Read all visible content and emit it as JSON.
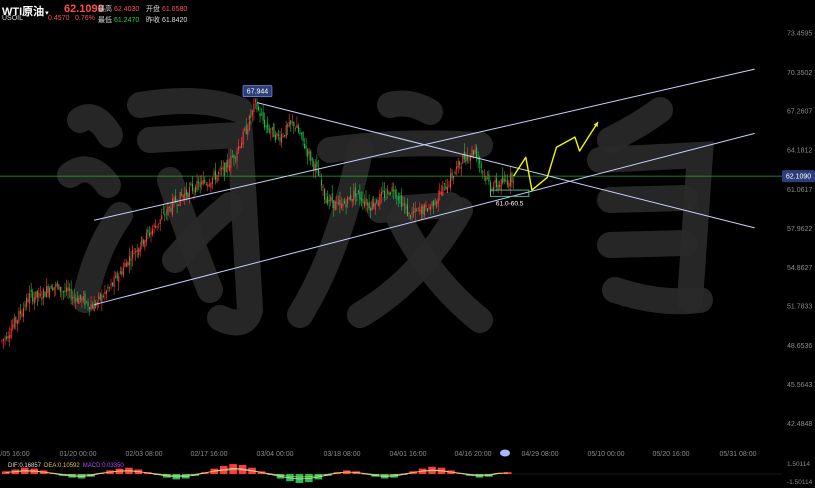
{
  "header": {
    "symbol": "WTI原油",
    "caret": "▾",
    "last_price": "62.1090",
    "sub_symbol": "USOIL",
    "change": "0.4570",
    "change_pct": "0.76%",
    "high_label": "最高",
    "high_value": "62.4030",
    "open_label": "开盘",
    "open_value": "61.6580",
    "low_label": "最低",
    "low_value": "61.2470",
    "prev_close_label": "昨收",
    "prev_close_value": "61.8420"
  },
  "macd": {
    "dif": "DIF:0.16857",
    "dea": "DEA:0.10592",
    "macd": "MACD:0.03350",
    "axis_top": "1.50114",
    "axis_bottom": "-1.50114"
  },
  "colors": {
    "background": "#000000",
    "up": "#ff3b3b",
    "down": "#1fc24a",
    "trendline": "#c8d2ff",
    "price_line": "#22aa33",
    "projection": "#f5f500",
    "price_tag": "#2c3f7a"
  },
  "chart_data": {
    "type": "candlestick",
    "price_axis_ticks": [
      "73.4595",
      "70.3502",
      "67.2607",
      "64.1812",
      "61.0617",
      "57.9622",
      "54.8627",
      "51.7833",
      "48.6536",
      "45.5643",
      "42.4848"
    ],
    "time_axis_ticks": [
      "/05 16:00",
      "01/20 00:00",
      "02/03 08:00",
      "02/17 16:00",
      "03/04 00:00",
      "03/18 08:00",
      "04/01 16:00",
      "04/16 20:00",
      "04/29 08:00",
      "05/10 00:00",
      "05/20 16:00",
      "05/31 08:00"
    ],
    "current_price": 62.109,
    "current_price_label": "62.1090",
    "peak_label": "67.944",
    "peak_value": 67.944,
    "support_zone": [
      61.0,
      60.5
    ],
    "support_zone_label": "61.0-60.5",
    "trend_path": [
      [
        0,
        49.0
      ],
      [
        10,
        50.8
      ],
      [
        18,
        52.6
      ],
      [
        25,
        52.5
      ],
      [
        32,
        53.5
      ],
      [
        38,
        53.1
      ],
      [
        48,
        52.5
      ],
      [
        60,
        51.8
      ],
      [
        72,
        53.5
      ],
      [
        85,
        56.0
      ],
      [
        100,
        58.2
      ],
      [
        112,
        60.0
      ],
      [
        122,
        61.0
      ],
      [
        135,
        61.8
      ],
      [
        145,
        62.6
      ],
      [
        152,
        64.0
      ],
      [
        158,
        65.5
      ],
      [
        165,
        67.8
      ],
      [
        172,
        66.0
      ],
      [
        180,
        65.2
      ],
      [
        190,
        66.3
      ],
      [
        198,
        64.3
      ],
      [
        205,
        62.5
      ],
      [
        210,
        60.5
      ],
      [
        220,
        59.6
      ],
      [
        230,
        60.8
      ],
      [
        240,
        59.8
      ],
      [
        255,
        61.2
      ],
      [
        265,
        59.0
      ],
      [
        278,
        59.6
      ],
      [
        290,
        61.5
      ],
      [
        300,
        63.5
      ],
      [
        308,
        64.2
      ],
      [
        313,
        62.5
      ],
      [
        318,
        61.3
      ],
      [
        325,
        61.5
      ],
      [
        333,
        62.1
      ]
    ],
    "trendlines": [
      {
        "from": [
          166,
          67.944
        ],
        "to": [
          490,
          58.0
        ]
      },
      {
        "from": [
          60,
          58.6
        ],
        "to": [
          490,
          70.6
        ]
      },
      {
        "from": [
          60,
          51.9
        ],
        "to": [
          490,
          65.5
        ]
      }
    ],
    "projection": [
      [
        333,
        62.1
      ],
      [
        341,
        63.6
      ],
      [
        345,
        61.0
      ],
      [
        355,
        62.0
      ],
      [
        361,
        64.4
      ],
      [
        373,
        65.2
      ],
      [
        376,
        64.1
      ],
      [
        388,
        66.4
      ]
    ],
    "macd_hist": [
      0.3,
      0.5,
      0.7,
      0.6,
      0.4,
      0.1,
      -0.2,
      -0.4,
      -0.5,
      -0.3,
      0.1,
      0.4,
      0.6,
      0.7,
      0.5,
      0.2,
      -0.1,
      -0.4,
      -0.6,
      -0.5,
      -0.2,
      0.2,
      0.6,
      0.9,
      1.1,
      1.0,
      0.7,
      0.3,
      -0.1,
      -0.5,
      -0.8,
      -1.0,
      -0.9,
      -0.6,
      -0.2,
      0.2,
      0.4,
      0.3,
      0.0,
      -0.3,
      -0.5,
      -0.4,
      -0.1,
      0.3,
      0.6,
      0.8,
      0.7,
      0.4,
      0.1,
      -0.2,
      -0.4,
      -0.3,
      0.1,
      0.2
    ]
  }
}
